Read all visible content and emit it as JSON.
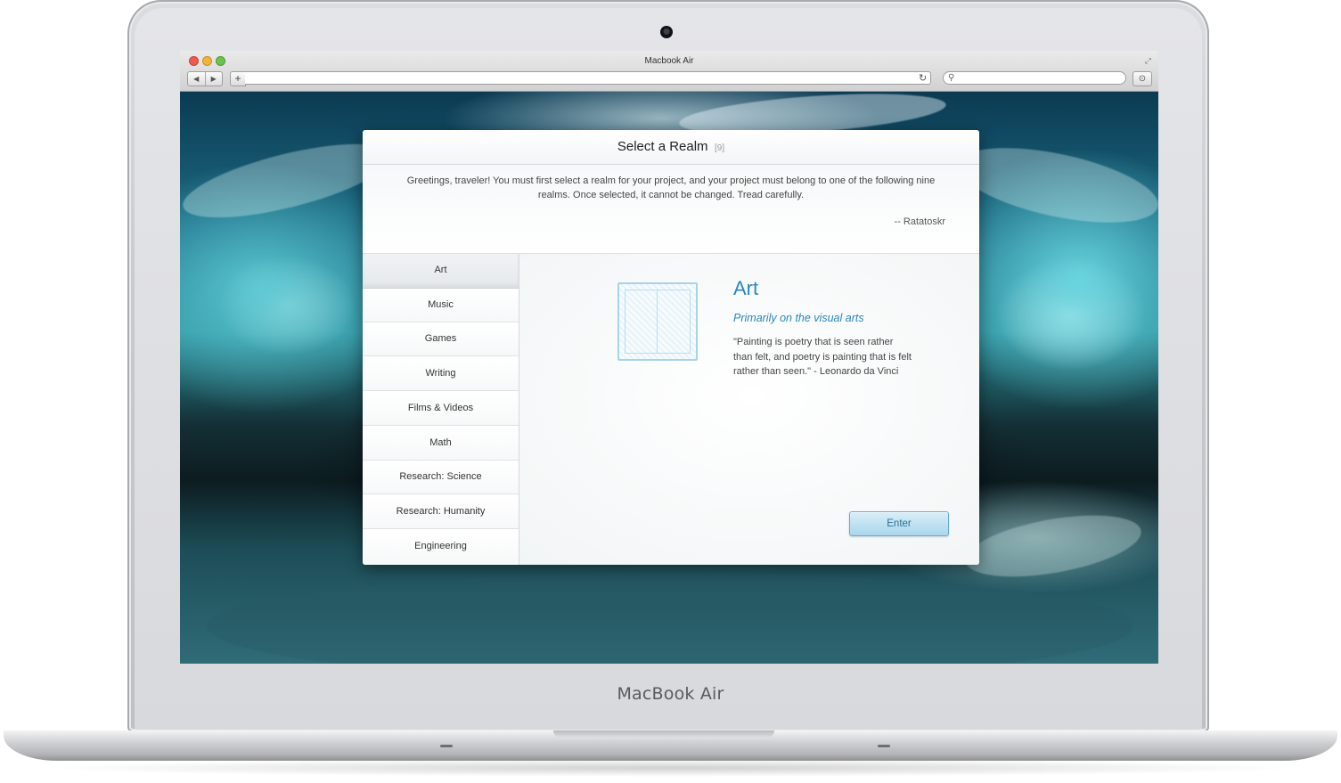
{
  "device": {
    "brand_label": "MacBook Air"
  },
  "browser": {
    "window_title": "Macbook Air",
    "url": "",
    "search_placeholder": "",
    "add_tab_label": "+",
    "back_label": "◀",
    "forward_label": "▶"
  },
  "modal": {
    "title": "Select a Realm",
    "count": "[9]",
    "intro_text": "Greetings, traveler! You must first select a realm for your project, and your project must belong to one of the following nine realms. Once selected, it cannot be changed. Tread carefully.",
    "intro_signature": "-- Ratatoskr",
    "realms": [
      {
        "label": "Art",
        "active": true
      },
      {
        "label": "Music"
      },
      {
        "label": "Games"
      },
      {
        "label": "Writing"
      },
      {
        "label": "Films & Videos"
      },
      {
        "label": "Math"
      },
      {
        "label": "Research: Science"
      },
      {
        "label": "Research: Humanity"
      },
      {
        "label": "Engineering"
      }
    ],
    "selected": {
      "name": "Art",
      "tagline": "Primarily on the visual arts",
      "quote": "\"Painting is poetry that is seen rather than felt, and poetry is painting that is felt rather than seen.\" - Leonardo da Vinci",
      "icon": "canvas-window-icon"
    },
    "enter_label": "Enter"
  },
  "colors": {
    "accent": "#2a87c0",
    "traffic_red": "#ee5a50",
    "traffic_yellow": "#f2b33b",
    "traffic_green": "#6cc44e"
  }
}
